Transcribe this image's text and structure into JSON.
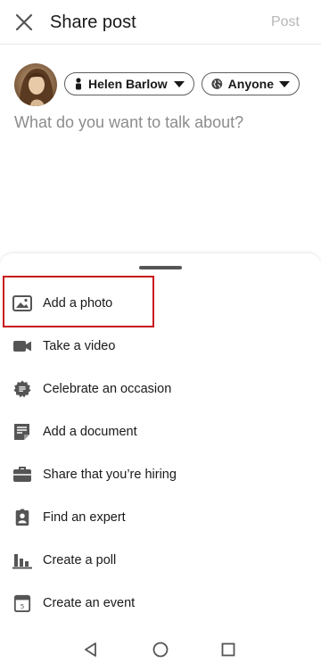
{
  "header": {
    "title": "Share post",
    "post_label": "Post"
  },
  "composer": {
    "author_name": "Helen Barlow",
    "visibility": "Anyone",
    "placeholder": "What do you want to talk about?"
  },
  "sheet": {
    "options": [
      {
        "label": "Add a photo",
        "icon": "photo-icon"
      },
      {
        "label": "Take a video",
        "icon": "video-camera-icon"
      },
      {
        "label": "Celebrate an occasion",
        "icon": "celebrate-badge-icon"
      },
      {
        "label": "Add a document",
        "icon": "document-icon"
      },
      {
        "label": "Share that you’re hiring",
        "icon": "briefcase-icon"
      },
      {
        "label": "Find an expert",
        "icon": "expert-id-icon"
      },
      {
        "label": "Create a poll",
        "icon": "poll-chart-icon"
      },
      {
        "label": "Create an event",
        "icon": "calendar-icon"
      }
    ]
  },
  "colors": {
    "highlight": "#c8161d",
    "post_disabled": "#b7b7b7",
    "placeholder": "#8c8c8c"
  }
}
